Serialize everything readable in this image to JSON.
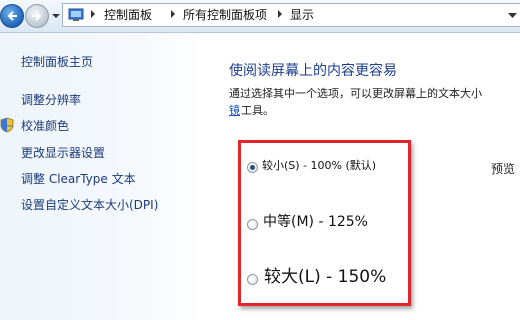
{
  "breadcrumb": {
    "items": [
      "控制面板",
      "所有控制面板项",
      "显示"
    ]
  },
  "sidebar": {
    "items": [
      {
        "label": "控制面板主页"
      },
      {
        "label": "调整分辨率"
      },
      {
        "label": "校准颜色"
      },
      {
        "label": "更改显示器设置"
      },
      {
        "label": "调整 ClearType 文本"
      },
      {
        "label": "设置自定义文本大小(DPI)"
      }
    ]
  },
  "main": {
    "title": "使阅读屏幕上的内容更容易",
    "description": "通过选择其中一个选项，可以更改屏幕上的文本大小",
    "link_fragment": "镜",
    "tail_text": "工具。",
    "options": [
      {
        "label": "较小(S) - 100% (默认)",
        "checked": true
      },
      {
        "label": "中等(M) - 125%",
        "checked": false
      },
      {
        "label": "较大(L) - 150%",
        "checked": false
      }
    ],
    "preview_label": "预览"
  },
  "colors": {
    "link": "#1a3b7a",
    "title": "#1e3f8c",
    "highlight": "#e0262a"
  }
}
